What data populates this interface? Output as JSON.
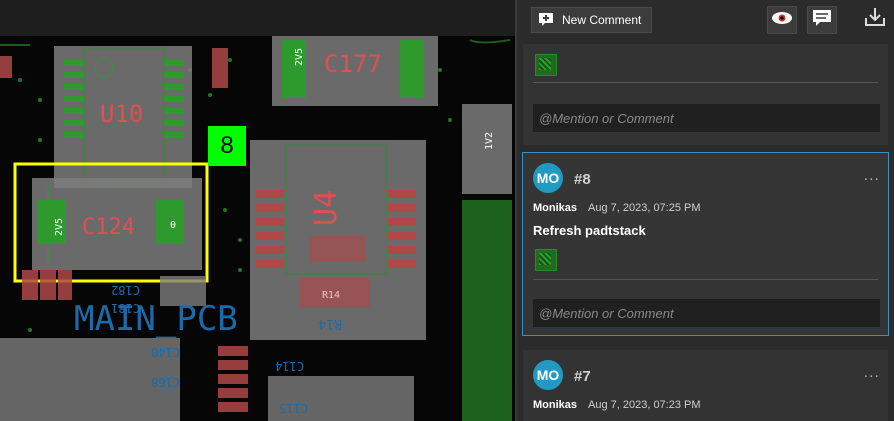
{
  "canvas": {
    "marker_label": "8",
    "components": {
      "u10": "U10",
      "c124": "C124",
      "c177": "C177",
      "u4": "U4",
      "r14": "R14",
      "r14b": "R14",
      "c182": "C182",
      "c181": "C181",
      "c140": "C140",
      "c168": "C168",
      "c114": "C114",
      "c115": "C115",
      "mainpcb": "MAIN_PCB",
      "net_2v5_a": "2V5",
      "net_2v5_b": "2V5",
      "net_1v2": "1V2",
      "pin0": "0"
    }
  },
  "panel": {
    "new_comment_label": "New Comment",
    "icons": [
      "new-comment-icon",
      "eye-icon",
      "comment-icon",
      "download-icon"
    ],
    "comments": [
      {
        "mention_placeholder": "@Mention or Comment"
      },
      {
        "avatar": "MO",
        "number": "#8",
        "author": "Monikas",
        "timestamp": "Aug 7, 2023, 07:25 PM",
        "body": "Refresh padtstack",
        "mention_placeholder": "@Mention or Comment",
        "menu": "..."
      },
      {
        "avatar": "MO",
        "number": "#7",
        "author": "Monikas",
        "timestamp": "Aug 7, 2023, 07:23 PM",
        "menu": "..."
      }
    ]
  },
  "colors": {
    "accent": "#1f9ac2",
    "selection": "#ffff00",
    "marker": "#00ff00"
  }
}
